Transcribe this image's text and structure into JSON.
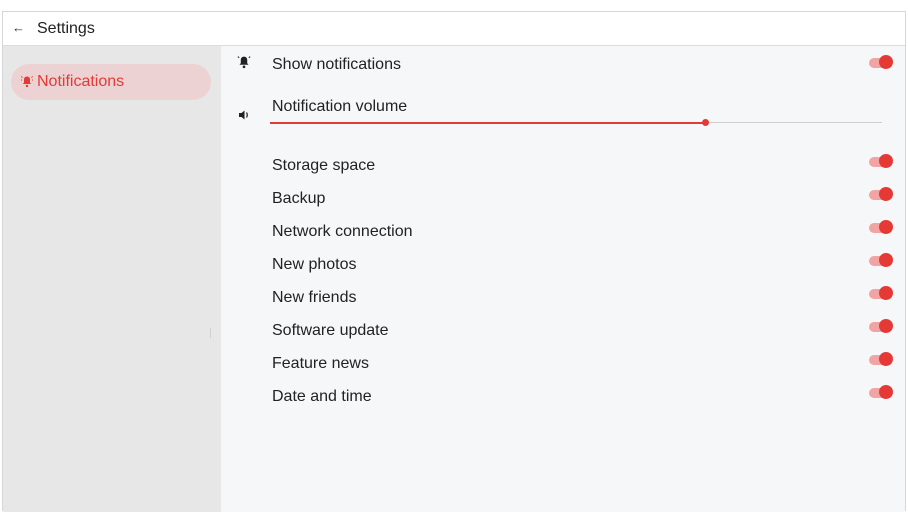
{
  "header": {
    "back_glyph": "←",
    "title": "Settings"
  },
  "sidebar": {
    "items": [
      {
        "label": "Notifications",
        "icon": "bell-alert-icon",
        "selected": true
      }
    ]
  },
  "main": {
    "show_notifications": {
      "label": "Show notifications",
      "icon": "bell-alert-icon",
      "on": true
    },
    "notification_volume": {
      "label": "Notification volume",
      "icon": "speaker-icon",
      "value_fraction": 0.71
    },
    "toggles": [
      {
        "label": "Storage space",
        "on": true
      },
      {
        "label": "Backup",
        "on": true
      },
      {
        "label": "Network connection",
        "on": true
      },
      {
        "label": "New photos",
        "on": true
      },
      {
        "label": "New friends",
        "on": true
      },
      {
        "label": "Software update",
        "on": true
      },
      {
        "label": "Feature news",
        "on": true
      },
      {
        "label": "Date and time",
        "on": true
      }
    ]
  },
  "colors": {
    "accent": "#e53935",
    "accent_light": "#f2a3a3",
    "selected_bg": "#ecd2d2",
    "sidebar_bg": "#e7e7e7",
    "content_bg": "#f6f7f9"
  }
}
